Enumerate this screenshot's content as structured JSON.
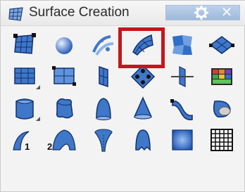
{
  "window": {
    "title": "Surface Creation",
    "close_glyph": "×"
  },
  "toolbar": {
    "selected_tool": "surface-from-network-of-curves",
    "tools": [
      {
        "name": "surface-from-corner-points-icon"
      },
      {
        "name": "sphere-icon"
      },
      {
        "name": "patch-surface-icon"
      },
      {
        "name": "surface-from-network-of-curves-icon"
      },
      {
        "name": "surface-from-edge-curves-icon"
      },
      {
        "name": "plane-from-points-icon"
      },
      {
        "name": "rectangular-plane-icon"
      },
      {
        "name": "rectangular-plane-grid-icon"
      },
      {
        "name": "vertical-plane-icon"
      },
      {
        "name": "surface-from-points-icon"
      },
      {
        "name": "cutting-plane-icon"
      },
      {
        "name": "heightfield-from-image-icon"
      },
      {
        "name": "extrude-curve-icon"
      },
      {
        "name": "extrude-closed-curve-icon"
      },
      {
        "name": "revolve-icon"
      },
      {
        "name": "cone-icon"
      },
      {
        "name": "sweep-1-rail-icon"
      },
      {
        "name": "rail-revolve-icon"
      },
      {
        "name": "loft-1-icon"
      },
      {
        "name": "loft-2-icon"
      },
      {
        "name": "twisted-surface-icon"
      },
      {
        "name": "drape-surface-icon"
      },
      {
        "name": "fit-surface-icon"
      },
      {
        "name": "point-grid-surface-icon"
      }
    ],
    "subscript_1": "1",
    "subscript_2": "2"
  },
  "colors": {
    "highlight": "#c4161c",
    "surface_blue": "#2f6fc6",
    "titlebar_accent": "#a8bfdc"
  }
}
